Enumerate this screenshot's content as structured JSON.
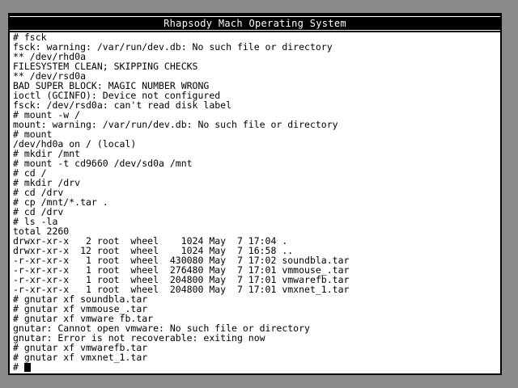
{
  "window": {
    "title": "Rhapsody Mach Operating System"
  },
  "terminal": {
    "lines": [
      "# fsck",
      "fsck: warning: /var/run/dev.db: No such file or directory",
      "** /dev/rhd0a",
      "FILESYSTEM CLEAN; SKIPPING CHECKS",
      "** /dev/rsd0a",
      "BAD SUPER BLOCK: MAGIC NUMBER WRONG",
      "ioctl (GCINFO): Device not configured",
      "fsck: /dev/rsd0a: can't read disk label",
      "# mount -w /",
      "mount: warning: /var/run/dev.db: No such file or directory",
      "# mount",
      "/dev/hd0a on / (local)",
      "# mkdir /mnt",
      "# mount -t cd9660 /dev/sd0a /mnt",
      "# cd /",
      "# mkdir /drv",
      "# cd /drv",
      "# cp /mnt/*.tar .",
      "# cd /drv",
      "# ls -la",
      "total 2260",
      "drwxr-xr-x   2 root  wheel    1024 May  7 17:04 .",
      "drwxr-xr-x  12 root  wheel    1024 May  7 16:58 ..",
      "-r-xr-xr-x   1 root  wheel  430080 May  7 17:02 soundbla.tar",
      "-r-xr-xr-x   1 root  wheel  276480 May  7 17:01 vmmouse_.tar",
      "-r-xr-xr-x   1 root  wheel  204800 May  7 17:01 vmwarefb.tar",
      "-r-xr-xr-x   1 root  wheel  204800 May  7 17:01 vmxnet_1.tar",
      "# gnutar xf soundbla.tar",
      "# gnutar xf vmmouse_.tar",
      "# gnutar xf vmware fb.tar",
      "gnutar: Cannot open vmware: No such file or directory",
      "gnutar: Error is not recoverable: exiting now",
      "# gnutar xf vmwarefb.tar",
      "# gnutar xf vmxnet_1.tar"
    ],
    "prompt": "# "
  }
}
